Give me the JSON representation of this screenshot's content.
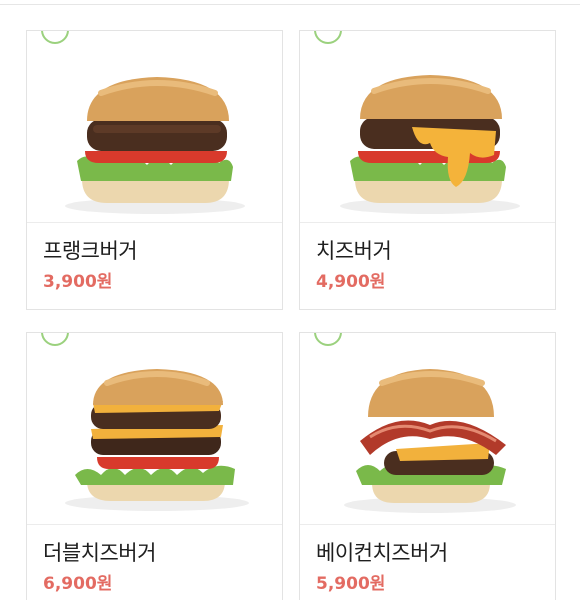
{
  "menu": {
    "items": [
      {
        "name": "프랭크버거",
        "price": "3,900원",
        "variant": "single"
      },
      {
        "name": "치즈버거",
        "price": "4,900원",
        "variant": "cheese"
      },
      {
        "name": "더블치즈버거",
        "price": "6,900원",
        "variant": "double"
      },
      {
        "name": "베이컨치즈버거",
        "price": "5,900원",
        "variant": "bacon"
      }
    ]
  },
  "colors": {
    "price": "#e36b62",
    "badge": "#9bd17e",
    "border": "#e3e3e3"
  },
  "icons": {
    "badge": "green-circle-badge-icon"
  }
}
